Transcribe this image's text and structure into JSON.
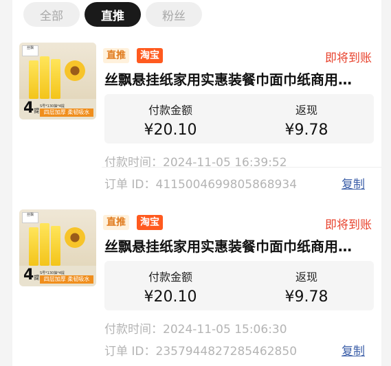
{
  "tabs": [
    {
      "label": "全部",
      "active": false
    },
    {
      "label": "直推",
      "active": true
    },
    {
      "label": "粉丝",
      "active": false
    }
  ],
  "orders": [
    {
      "tag_type": "直推",
      "platform": "淘宝",
      "status": "即将到账",
      "title": "丝飘悬挂纸家用实惠装餐巾面巾纸商用…",
      "thumb": {
        "count": "4",
        "count_unit": "提",
        "banner": "四层加厚 柔韧吸水",
        "brand": "丝飘",
        "spec": "S号*130抽*4提"
      },
      "pay_label": "付款金额",
      "pay_value": "¥20.10",
      "cash_label": "返现",
      "cash_value": "¥9.78",
      "time_text": "付款时间：2024-11-05 16:39:52",
      "order_id_text": "订单 ID：4115004699805868934",
      "copy_label": "复制"
    },
    {
      "tag_type": "直推",
      "platform": "淘宝",
      "status": "即将到账",
      "title": "丝飘悬挂纸家用实惠装餐巾面巾纸商用…",
      "thumb": {
        "count": "4",
        "count_unit": "提",
        "banner": "四层加厚 柔韧吸水",
        "brand": "丝飘",
        "spec": "S号*130抽*4提"
      },
      "pay_label": "付款金额",
      "pay_value": "¥20.10",
      "cash_label": "返现",
      "cash_value": "¥9.78",
      "time_text": "付款时间：2024-11-05 15:06:30",
      "order_id_text": "订单 ID：2357944827285462850",
      "copy_label": "复制"
    }
  ],
  "colors": {
    "status": "#e8432e",
    "taobao": "#ff5a1f",
    "zhitui_text": "#e07a1c",
    "active_tab": "#1a1a1a",
    "copy_link": "#3c5fa8"
  },
  "icons": {
    "product_thumbnail": "tissue-pack-image"
  }
}
